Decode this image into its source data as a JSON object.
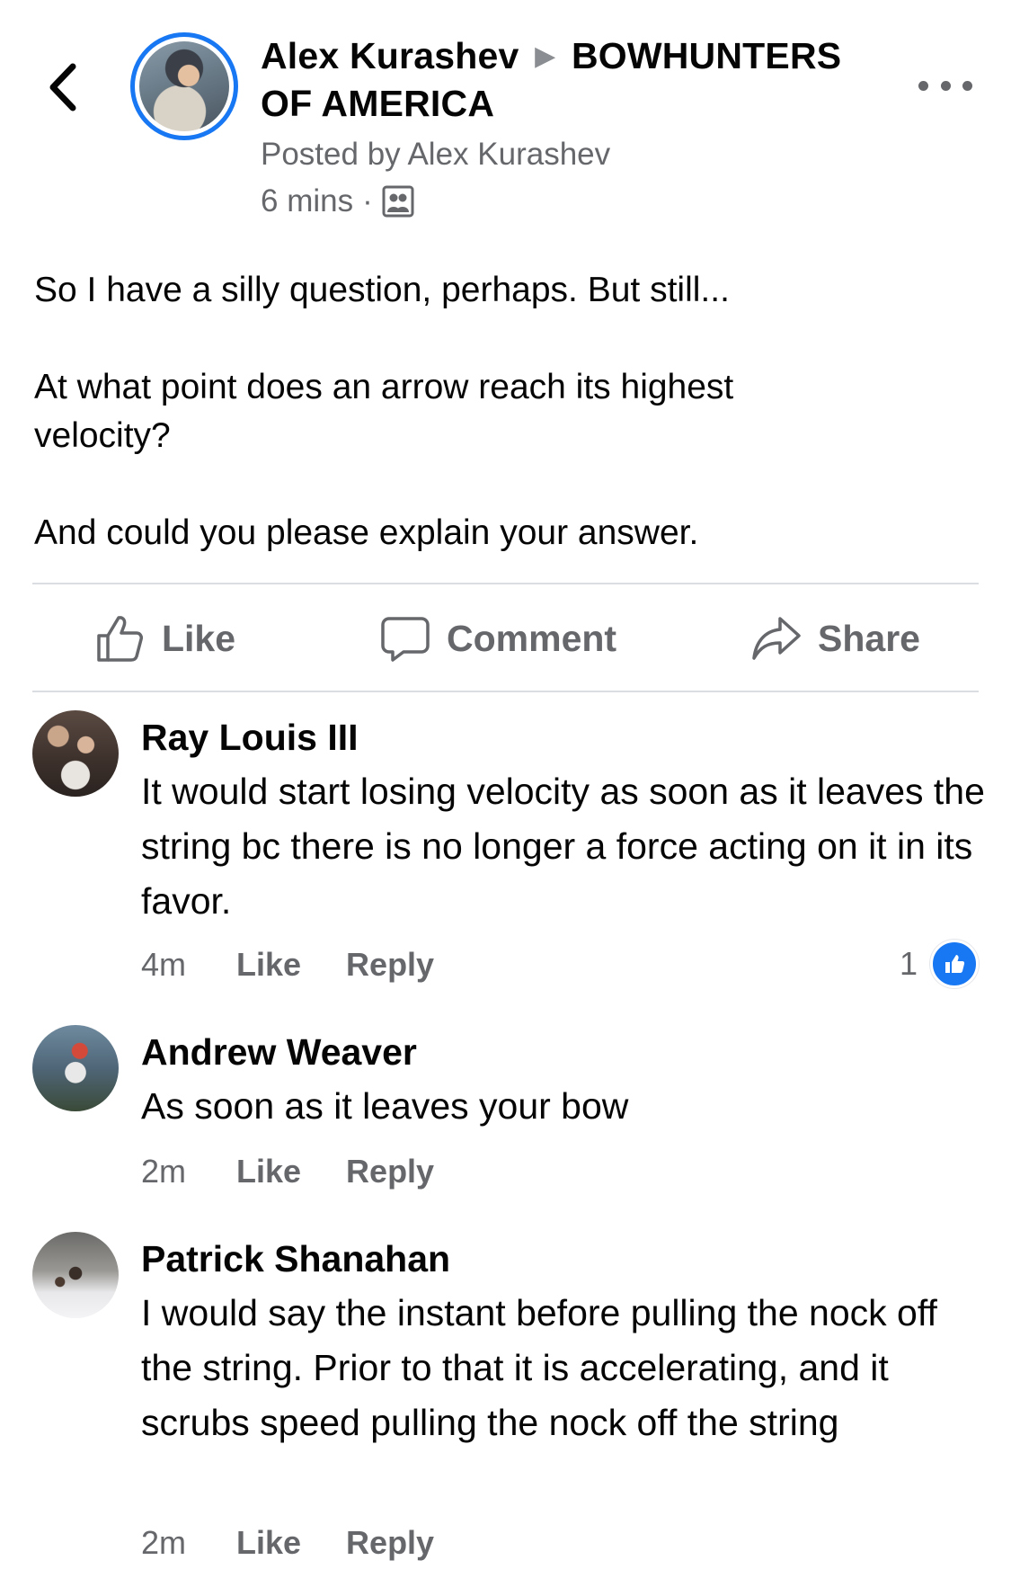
{
  "header": {
    "author": "Alex Kurashev",
    "group": "BOWHUNTERS OF AMERICA",
    "posted_by": "Posted by Alex Kurashev",
    "time": "6 mins",
    "separator": "·",
    "audience_icon": "group-members-icon",
    "back_icon": "chevron-left-icon",
    "more_icon": "more-horizontal-icon"
  },
  "post": {
    "paragraphs": [
      "So I have a silly question, perhaps. But still...",
      "At what point does an arrow reach its highest velocity?",
      "And could you please explain your answer."
    ]
  },
  "actions": {
    "like_label": "Like",
    "comment_label": "Comment",
    "share_label": "Share"
  },
  "comments": [
    {
      "name": "Ray Louis III",
      "text": "It would start losing velocity as soon as it leaves the string bc there is no longer a force acting on it in its favor.",
      "time": "4m",
      "like_label": "Like",
      "reply_label": "Reply",
      "reaction_count": "1"
    },
    {
      "name": "Andrew Weaver",
      "text": "As soon as it leaves your bow",
      "time": "2m",
      "like_label": "Like",
      "reply_label": "Reply"
    },
    {
      "name": "Patrick Shanahan",
      "text": "I would say the instant before pulling the nock off the string. Prior to that it is accelerating, and it scrubs speed pulling the nock off the string",
      "time": "2m",
      "like_label": "Like",
      "reply_label": "Reply"
    }
  ],
  "colors": {
    "accent": "#1877f2",
    "secondary_text": "#65676b",
    "divider": "#dadde1"
  }
}
